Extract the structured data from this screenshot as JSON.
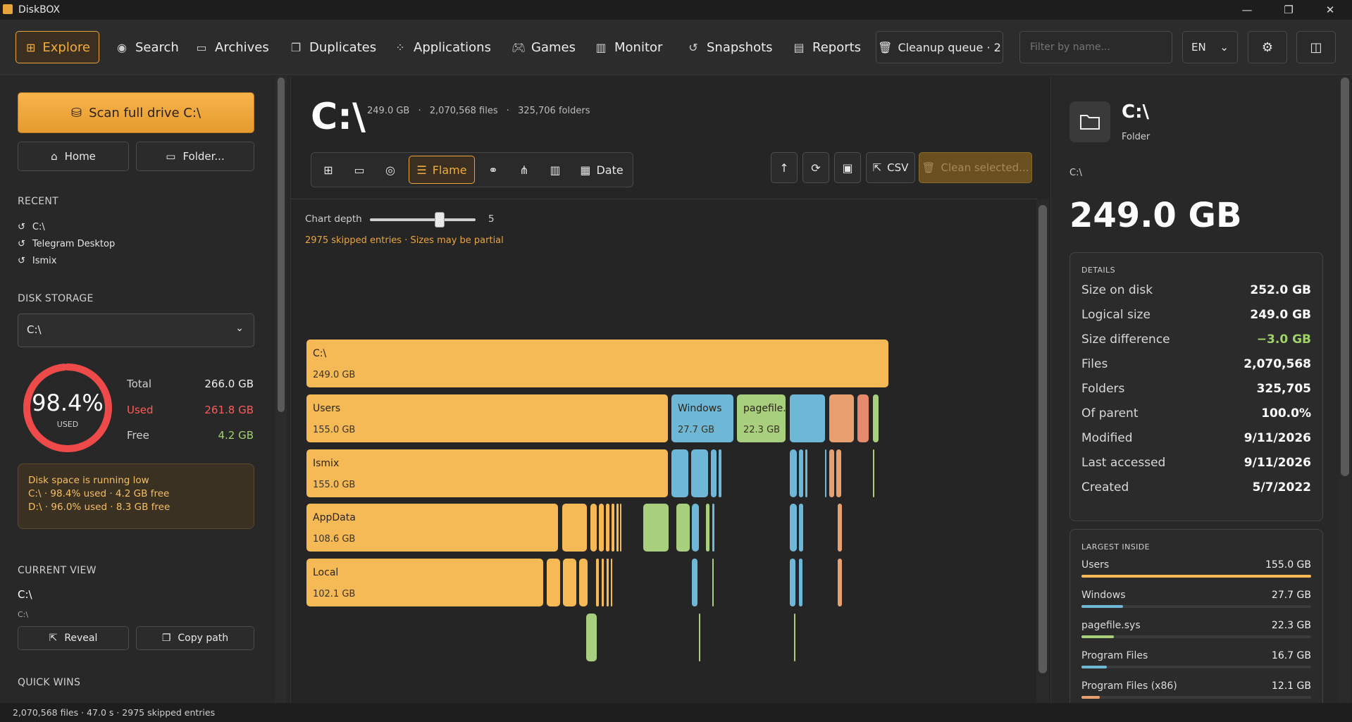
{
  "window": {
    "title": "DiskBOX",
    "minimize": "—",
    "restore": "❐",
    "close": "✕"
  },
  "nav": {
    "items": [
      {
        "label": "Explore",
        "icon": "grid-icon"
      },
      {
        "label": "Search",
        "icon": "eye-icon"
      },
      {
        "label": "Archives",
        "icon": "folder-icon"
      },
      {
        "label": "Duplicates",
        "icon": "copy-icon"
      },
      {
        "label": "Applications",
        "icon": "apps-icon"
      },
      {
        "label": "Games",
        "icon": "gamepad-icon"
      },
      {
        "label": "Monitor",
        "icon": "bar-chart-icon"
      },
      {
        "label": "Snapshots",
        "icon": "history-icon"
      },
      {
        "label": "Reports",
        "icon": "report-icon"
      }
    ],
    "cleanup_queue": "Cleanup queue · 2",
    "filter_placeholder": "Filter by name...",
    "language": "EN"
  },
  "left": {
    "scan_label": "Scan full drive  C:\\",
    "home_label": "Home",
    "folder_label": "Folder...",
    "recent_heading": "RECENT",
    "recent": [
      "C:\\",
      "Telegram Desktop",
      "Ismix"
    ],
    "disk_heading": "DISK STORAGE",
    "drive": "C:\\",
    "gauge_pct": "98.4%",
    "gauge_used_fraction": 0.984,
    "gauge_label": "USED",
    "stats": [
      {
        "label": "Total",
        "value": "266.0 GB",
        "color": "#eeeeee"
      },
      {
        "label": "Used",
        "value": "261.8 GB",
        "color": "#ff5a5a"
      },
      {
        "label": "Free",
        "value": "4.2 GB",
        "color": "#9fd36a"
      }
    ],
    "warning_title": "Disk space is running low",
    "warning_lines": [
      "C:\\ · 98.4% used · 4.2 GB free",
      "D:\\ · 96.0% used · 8.3 GB free"
    ],
    "current_heading": "CURRENT VIEW",
    "current_name": "C:\\",
    "current_path": "C:\\",
    "reveal_label": "Reveal",
    "copy_label": "Copy path",
    "quick_heading": "QUICK WINS"
  },
  "center": {
    "path": "C:\\",
    "meta": [
      "249.0 GB",
      "2,070,568 files",
      "325,706 folders"
    ],
    "views": [
      "Flame",
      "Date"
    ],
    "csv_label": "CSV",
    "clean_label": "Clean selected...",
    "depth_label": "Chart depth",
    "depth_value": "5",
    "depth_fraction": 0.66,
    "skip_note": "2975 skipped entries · Sizes may be partial",
    "flame_labels": {
      "root": {
        "name": "C:\\",
        "size": "249.0 GB"
      },
      "users": {
        "name": "Users",
        "size": "155.0 GB"
      },
      "windows": {
        "name": "Windows",
        "size": "27.7 GB"
      },
      "pagefile": {
        "name": "pagefile...",
        "size": "22.3 GB"
      },
      "ismix": {
        "name": "Ismix",
        "size": "155.0 GB"
      },
      "appdata": {
        "name": "AppData",
        "size": "108.6 GB"
      },
      "local": {
        "name": "Local",
        "size": "102.1 GB"
      }
    },
    "colors": {
      "orange": "#f5b955",
      "blue": "#6fb7d6",
      "green": "#a7cf7d",
      "salmon": "#e9a070",
      "coral": "#e58a6d"
    }
  },
  "right": {
    "name": "C:\\",
    "type": "Folder",
    "path": "C:\\",
    "size": "249.0 GB",
    "details_heading": "DETAILS",
    "details": [
      {
        "label": "Size on disk",
        "value": "252.0 GB"
      },
      {
        "label": "Logical size",
        "value": "249.0 GB"
      },
      {
        "label": "Size difference",
        "value": "−3.0 GB"
      },
      {
        "label": "Files",
        "value": "2,070,568"
      },
      {
        "label": "Folders",
        "value": "325,705"
      },
      {
        "label": "Of parent",
        "value": "100.0%"
      },
      {
        "label": "Modified",
        "value": "9/11/2026"
      },
      {
        "label": "Last accessed",
        "value": "9/11/2026"
      },
      {
        "label": "Created",
        "value": "5/7/2022"
      }
    ],
    "largest_heading": "LARGEST INSIDE",
    "largest": [
      {
        "name": "Users",
        "size": "155.0 GB",
        "fraction": 1.0,
        "color": "#f5b955"
      },
      {
        "name": "Windows",
        "size": "27.7 GB",
        "fraction": 0.18,
        "color": "#6fb7d6"
      },
      {
        "name": "pagefile.sys",
        "size": "22.3 GB",
        "fraction": 0.14,
        "color": "#a7cf7d"
      },
      {
        "name": "Program Files",
        "size": "16.7 GB",
        "fraction": 0.11,
        "color": "#6fb7d6"
      },
      {
        "name": "Program Files (x86)",
        "size": "12.1 GB",
        "fraction": 0.08,
        "color": "#e9a070"
      }
    ]
  },
  "status": "2,070,568 files · 47.0 s · 2975 skipped entries"
}
